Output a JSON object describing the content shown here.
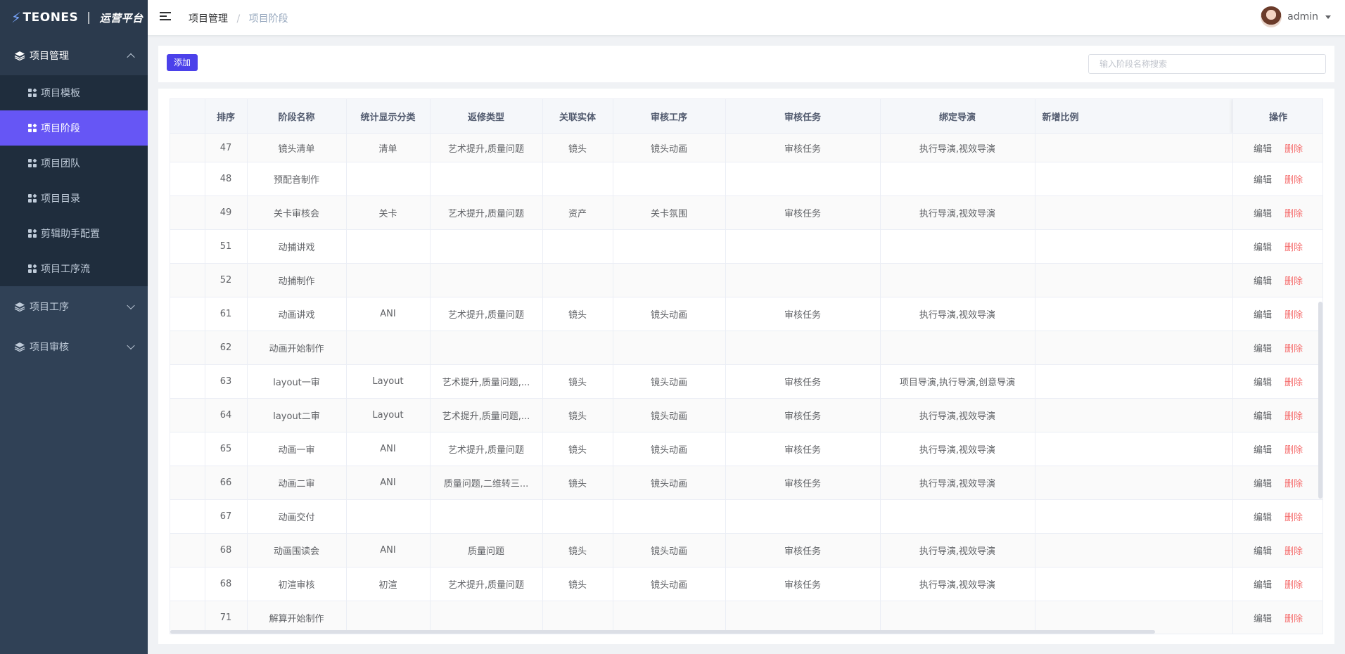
{
  "logo": {
    "brand": "TEONES",
    "separator": "|",
    "platform": "运营平台"
  },
  "sidebar": {
    "groups": [
      {
        "label": "项目管理",
        "icon": "layers-icon",
        "expanded": true,
        "items": [
          {
            "label": "项目模板"
          },
          {
            "label": "项目阶段",
            "active": true
          },
          {
            "label": "项目团队"
          },
          {
            "label": "项目目录"
          },
          {
            "label": "剪辑助手配置"
          },
          {
            "label": "项目工序流"
          }
        ]
      },
      {
        "label": "项目工序",
        "icon": "layers-icon",
        "expanded": false
      },
      {
        "label": "项目审核",
        "icon": "layers-icon",
        "expanded": false
      }
    ]
  },
  "header": {
    "breadcrumb": [
      "项目管理",
      "项目阶段"
    ],
    "breadcrumb_sep": "/",
    "user": {
      "name": "admin"
    }
  },
  "toolbar": {
    "add_label": "添加",
    "search_placeholder": "输入阶段名称搜索"
  },
  "table": {
    "columns": [
      "排序",
      "阶段名称",
      "统计显示分类",
      "返修类型",
      "关联实体",
      "审核工序",
      "审核任务",
      "绑定导演",
      "新增比例",
      "操作"
    ],
    "edit_label": "编辑",
    "delete_label": "删除",
    "rows": [
      {
        "order": "47",
        "name": "镜头清单",
        "category": "清单",
        "rework": "艺术提升,质量问题",
        "entity": "镜头",
        "process": "镜头动画",
        "task": "审核任务",
        "director": "执行导演,视效导演",
        "ratio": ""
      },
      {
        "order": "48",
        "name": "预配音制作",
        "category": "",
        "rework": "",
        "entity": "",
        "process": "",
        "task": "",
        "director": "",
        "ratio": ""
      },
      {
        "order": "49",
        "name": "关卡审核会",
        "category": "关卡",
        "rework": "艺术提升,质量问题",
        "entity": "资产",
        "process": "关卡氛围",
        "task": "审核任务",
        "director": "执行导演,视效导演",
        "ratio": ""
      },
      {
        "order": "51",
        "name": "动捕讲戏",
        "category": "",
        "rework": "",
        "entity": "",
        "process": "",
        "task": "",
        "director": "",
        "ratio": ""
      },
      {
        "order": "52",
        "name": "动捕制作",
        "category": "",
        "rework": "",
        "entity": "",
        "process": "",
        "task": "",
        "director": "",
        "ratio": ""
      },
      {
        "order": "61",
        "name": "动画讲戏",
        "category": "ANI",
        "rework": "艺术提升,质量问题",
        "entity": "镜头",
        "process": "镜头动画",
        "task": "审核任务",
        "director": "执行导演,视效导演",
        "ratio": ""
      },
      {
        "order": "62",
        "name": "动画开始制作",
        "category": "",
        "rework": "",
        "entity": "",
        "process": "",
        "task": "",
        "director": "",
        "ratio": ""
      },
      {
        "order": "63",
        "name": "layout一审",
        "category": "Layout",
        "rework": "艺术提升,质量问题,...",
        "entity": "镜头",
        "process": "镜头动画",
        "task": "审核任务",
        "director": "项目导演,执行导演,创意导演",
        "ratio": ""
      },
      {
        "order": "64",
        "name": "layout二审",
        "category": "Layout",
        "rework": "艺术提升,质量问题,...",
        "entity": "镜头",
        "process": "镜头动画",
        "task": "审核任务",
        "director": "执行导演,视效导演",
        "ratio": ""
      },
      {
        "order": "65",
        "name": "动画一审",
        "category": "ANI",
        "rework": "艺术提升,质量问题",
        "entity": "镜头",
        "process": "镜头动画",
        "task": "审核任务",
        "director": "执行导演,视效导演",
        "ratio": ""
      },
      {
        "order": "66",
        "name": "动画二审",
        "category": "ANI",
        "rework": "质量问题,二维转三...",
        "entity": "镜头",
        "process": "镜头动画",
        "task": "审核任务",
        "director": "执行导演,视效导演",
        "ratio": ""
      },
      {
        "order": "67",
        "name": "动画交付",
        "category": "",
        "rework": "",
        "entity": "",
        "process": "",
        "task": "",
        "director": "",
        "ratio": ""
      },
      {
        "order": "68",
        "name": "动画围读会",
        "category": "ANI",
        "rework": "质量问题",
        "entity": "镜头",
        "process": "镜头动画",
        "task": "审核任务",
        "director": "执行导演,视效导演",
        "ratio": ""
      },
      {
        "order": "68",
        "name": "初渲审核",
        "category": "初渲",
        "rework": "艺术提升,质量问题",
        "entity": "镜头",
        "process": "镜头动画",
        "task": "审核任务",
        "director": "执行导演,视效导演",
        "ratio": ""
      },
      {
        "order": "71",
        "name": "解算开始制作",
        "category": "",
        "rework": "",
        "entity": "",
        "process": "",
        "task": "",
        "director": "",
        "ratio": ""
      }
    ]
  }
}
